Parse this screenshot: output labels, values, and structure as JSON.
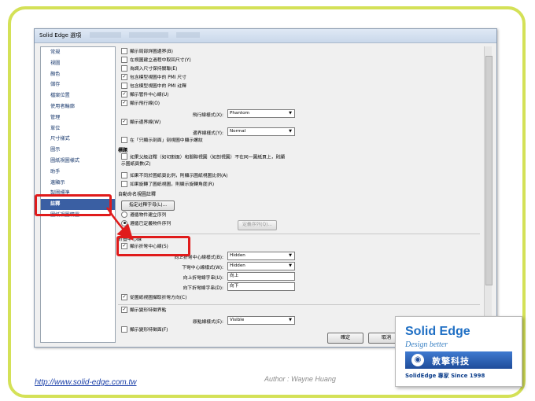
{
  "dialog": {
    "title": "Solid Edge 選項",
    "ok_label": "確定",
    "cancel_label": "取消"
  },
  "sidebar": {
    "items": [
      {
        "label": "常規"
      },
      {
        "label": "視圖"
      },
      {
        "label": "顏色"
      },
      {
        "label": "儲存"
      },
      {
        "label": "檔案位置"
      },
      {
        "label": "使用者輪廓"
      },
      {
        "label": "管理"
      },
      {
        "label": "單位"
      },
      {
        "label": "尺寸樣式"
      },
      {
        "label": "圖示"
      },
      {
        "label": "圖紙視圖樣式"
      },
      {
        "label": "助手"
      },
      {
        "label": "邊顯示"
      },
      {
        "label": "製圖標準"
      },
      {
        "label": "註釋",
        "selected": true
      },
      {
        "label": "圖紙視圖精靈"
      }
    ]
  },
  "options": {
    "opt1": "顯示局部詳圖邊界(B)",
    "opt2": "在視圖建立過程中取回尺寸(Y)",
    "opt3": "為調入尺寸保持關聯(E)",
    "opt4": "包含模型視圖中的 PMI 尺寸",
    "opt5": "包含模型視圖中的 PMI 註釋",
    "opt6": "顯示管件中心線(U)",
    "opt7": "顯示飛行線(O)",
    "flight_style_label": "飛行線樣式(X):",
    "flight_style_value": "Phantom",
    "opt8": "顯示邊界線(W)",
    "border_style_label": "邊界線樣式(Y):",
    "border_style_value": "Normal",
    "opt9": "在「只顯示剖面」剖視圖中顯示螺紋"
  },
  "labels_section": {
    "title": "標題",
    "opt1": "如果父級註釋（如切割面）和關聯視圖（如剖視圖）不在同一圖紙頁上，則顯示圖紙頁數(Z)",
    "opt2": "如果不同於圖紙頁比例，則顯示圖紙視圖比例(A)",
    "opt3": "如果旋轉了圖紙視圖，則顯示旋轉角度(R)"
  },
  "auto_name": {
    "title": "自動命名視圖註釋",
    "assign_button": "指定註釋字母(L)...",
    "radio1": "遵循物件建立序列",
    "radio2": "遵循已定義物件序列",
    "define_button": "定義序列(Q)..."
  },
  "fold": {
    "title": "折疊中心線",
    "opt1": "顯示折彎中心線(S)",
    "up_style_label": "向上折彎中心線樣式(B):",
    "up_style_value": "Hidden",
    "down_style_label": "下彎中心線樣式(W):",
    "down_style_value": "Hidden",
    "up_label_label": "向上折彎線字串(U):",
    "up_label_value": "向上",
    "down_label_label": "向下折彎線字串(D):",
    "down_label_value": "向下",
    "opt2": "從圖紙視圖擷取折彎方向(C)",
    "opt3": "顯示變形特徵界點",
    "origin_style_label": "原點線樣式(E):",
    "origin_style_value": "Visible",
    "opt4": "顯示變形特徵面(F)"
  },
  "logo": {
    "brand": "Solid Edge",
    "tagline": "Design better",
    "company": "敦擎科技",
    "since": "SolidEdge 專家 Since 1998"
  },
  "footer": {
    "url": "http://www.solid-edge.com.tw",
    "author": "Author : Wayne Huang"
  },
  "colors": {
    "frame": "#d4e157",
    "highlight": "#e01b1b",
    "selection": "#3a5fa3"
  }
}
